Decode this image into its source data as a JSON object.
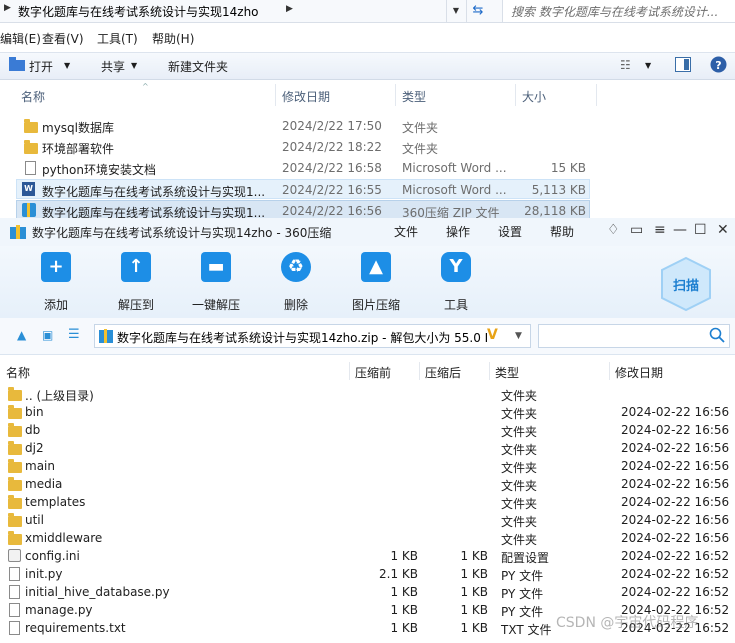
{
  "explorer": {
    "breadcrumb": "数字化题库与在线考试系统设计与实现14zho",
    "search_placeholder": "搜索 数字化题库与在线考试系统设计...",
    "menu": [
      "编辑(E)",
      "查看(V)",
      "工具(T)",
      "帮助(H)"
    ],
    "toolbar": {
      "open": "打开",
      "share": "共享",
      "new_folder": "新建文件夹"
    },
    "columns": {
      "name": "名称",
      "date": "修改日期",
      "type": "类型",
      "size": "大小"
    },
    "rows": [
      {
        "name": "mysql数据库",
        "date": "2024/2/22 17:50",
        "type": "文件夹",
        "size": "",
        "icon": "folder-icon"
      },
      {
        "name": "环境部署软件",
        "date": "2024/2/22 18:22",
        "type": "文件夹",
        "size": "",
        "icon": "folder-icon"
      },
      {
        "name": "python环境安装文档",
        "date": "2024/2/22 16:58",
        "type": "Microsoft Word ...",
        "size": "15 KB",
        "icon": "document-icon"
      },
      {
        "name": "数字化题库与在线考试系统设计与实现1...",
        "date": "2024/2/22 16:55",
        "type": "Microsoft Word ...",
        "size": "5,113 KB",
        "icon": "word-icon"
      },
      {
        "name": "数字化题库与在线考试系统设计与实现1...",
        "date": "2024/2/22 16:56",
        "type": "360压缩 ZIP 文件",
        "size": "28,118 KB",
        "icon": "zip-icon"
      }
    ]
  },
  "zip": {
    "title": "数字化题库与在线考试系统设计与实现14zho - 360压缩",
    "menu": [
      "文件",
      "操作",
      "设置",
      "帮助"
    ],
    "tools": [
      {
        "label": "添加",
        "icon": "add-icon"
      },
      {
        "label": "解压到",
        "icon": "extract-to-icon"
      },
      {
        "label": "一键解压",
        "icon": "one-click-extract-icon"
      },
      {
        "label": "删除",
        "icon": "delete-icon"
      },
      {
        "label": "图片压缩",
        "icon": "image-compress-icon"
      },
      {
        "label": "工具",
        "icon": "tools-icon"
      }
    ],
    "scan_label": "扫描",
    "path": "数字化题库与在线考试系统设计与实现14zho.zip - 解包大小为 55.0 I",
    "columns": {
      "name": "名称",
      "compressed": "压缩前",
      "after": "压缩后",
      "type": "类型",
      "modified": "修改日期"
    },
    "rows": [
      {
        "name": ".. (上级目录)",
        "before": "",
        "after": "",
        "type": "文件夹",
        "date": "",
        "icon": "folder-icon"
      },
      {
        "name": "bin",
        "before": "",
        "after": "",
        "type": "文件夹",
        "date": "2024-02-22 16:56",
        "icon": "folder-icon"
      },
      {
        "name": "db",
        "before": "",
        "after": "",
        "type": "文件夹",
        "date": "2024-02-22 16:56",
        "icon": "folder-icon"
      },
      {
        "name": "dj2",
        "before": "",
        "after": "",
        "type": "文件夹",
        "date": "2024-02-22 16:56",
        "icon": "folder-icon"
      },
      {
        "name": "main",
        "before": "",
        "after": "",
        "type": "文件夹",
        "date": "2024-02-22 16:56",
        "icon": "folder-icon"
      },
      {
        "name": "media",
        "before": "",
        "after": "",
        "type": "文件夹",
        "date": "2024-02-22 16:56",
        "icon": "folder-icon"
      },
      {
        "name": "templates",
        "before": "",
        "after": "",
        "type": "文件夹",
        "date": "2024-02-22 16:56",
        "icon": "folder-icon"
      },
      {
        "name": "util",
        "before": "",
        "after": "",
        "type": "文件夹",
        "date": "2024-02-22 16:56",
        "icon": "folder-icon"
      },
      {
        "name": "xmiddleware",
        "before": "",
        "after": "",
        "type": "文件夹",
        "date": "2024-02-22 16:56",
        "icon": "folder-icon"
      },
      {
        "name": "config.ini",
        "before": "1 KB",
        "after": "1 KB",
        "type": "配置设置",
        "date": "2024-02-22 16:52",
        "icon": "ini-file-icon"
      },
      {
        "name": "init.py",
        "before": "2.1 KB",
        "after": "1 KB",
        "type": "PY 文件",
        "date": "2024-02-22 16:52",
        "icon": "file-icon"
      },
      {
        "name": "initial_hive_database.py",
        "before": "1 KB",
        "after": "1 KB",
        "type": "PY 文件",
        "date": "2024-02-22 16:52",
        "icon": "file-icon"
      },
      {
        "name": "manage.py",
        "before": "1 KB",
        "after": "1 KB",
        "type": "PY 文件",
        "date": "2024-02-22 16:52",
        "icon": "file-icon"
      },
      {
        "name": "requirements.txt",
        "before": "1 KB",
        "after": "1 KB",
        "type": "TXT 文件",
        "date": "2024-02-22 16:52",
        "icon": "file-icon"
      }
    ]
  },
  "watermark": "CSDN @宇宙代码程序"
}
